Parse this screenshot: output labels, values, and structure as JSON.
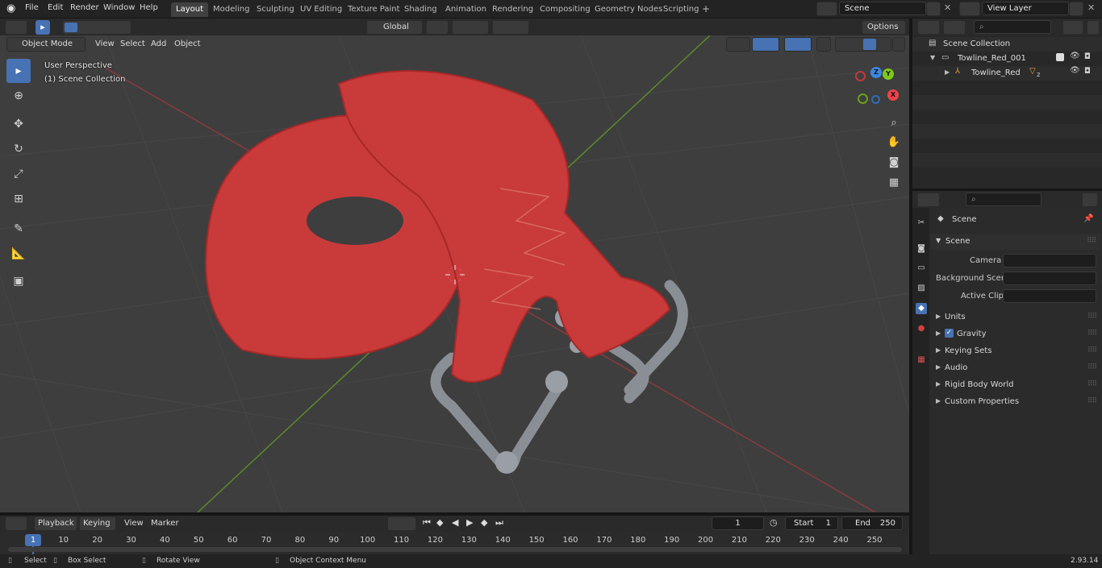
{
  "top_menu": [
    "File",
    "Edit",
    "Render",
    "Window",
    "Help"
  ],
  "workspaces": [
    "Layout",
    "Modeling",
    "Sculpting",
    "UV Editing",
    "Texture Paint",
    "Shading",
    "Animation",
    "Rendering",
    "Compositing",
    "Geometry Nodes",
    "Scripting"
  ],
  "active_workspace": "Layout",
  "scene_name": "Scene",
  "view_layer": "View Layer",
  "viewport_header": {
    "mode": "Object Mode",
    "menus": [
      "View",
      "Select",
      "Add",
      "Object"
    ],
    "orientation": "Global",
    "options": "Options"
  },
  "viewport_overlay": {
    "perspective": "User Perspective",
    "collection": "(1) Scene Collection"
  },
  "gizmo_axes": {
    "x": "X",
    "y": "Y",
    "z": "Z"
  },
  "outliner": {
    "root": "Scene Collection",
    "collection": "Towline_Red_001",
    "object": "Towline_Red",
    "modifier_count": "2"
  },
  "properties": {
    "breadcrumb": "Scene",
    "section": "Scene",
    "fields": [
      {
        "label": "Camera",
        "value": ""
      },
      {
        "label": "Background Scene",
        "value": ""
      },
      {
        "label": "Active Clip",
        "value": ""
      }
    ],
    "subpanels": [
      "Units",
      "Gravity",
      "Keying Sets",
      "Audio",
      "Rigid Body World",
      "Custom Properties"
    ],
    "gravity_checked": true
  },
  "timeline": {
    "menus": [
      "Playback",
      "Keying",
      "View",
      "Marker"
    ],
    "current_frame": "1",
    "start_label": "Start",
    "start": "1",
    "end_label": "End",
    "end": "250",
    "ticks": [
      "1",
      "10",
      "20",
      "30",
      "40",
      "50",
      "60",
      "70",
      "80",
      "90",
      "100",
      "110",
      "120",
      "130",
      "140",
      "150",
      "160",
      "170",
      "180",
      "190",
      "200",
      "210",
      "220",
      "230",
      "240",
      "250"
    ]
  },
  "status_bar": {
    "select": "Select",
    "box_select": "Box Select",
    "rotate_view": "Rotate View",
    "context_menu": "Object Context Menu",
    "version": "2.93.14"
  },
  "colors": {
    "accent": "#4772b3",
    "strap_red": "#c93a3a",
    "shackle_gray": "#8a8e95",
    "x_axis": "#f0424b",
    "y_axis": "#7ec81d",
    "z_axis": "#3b86e2"
  }
}
